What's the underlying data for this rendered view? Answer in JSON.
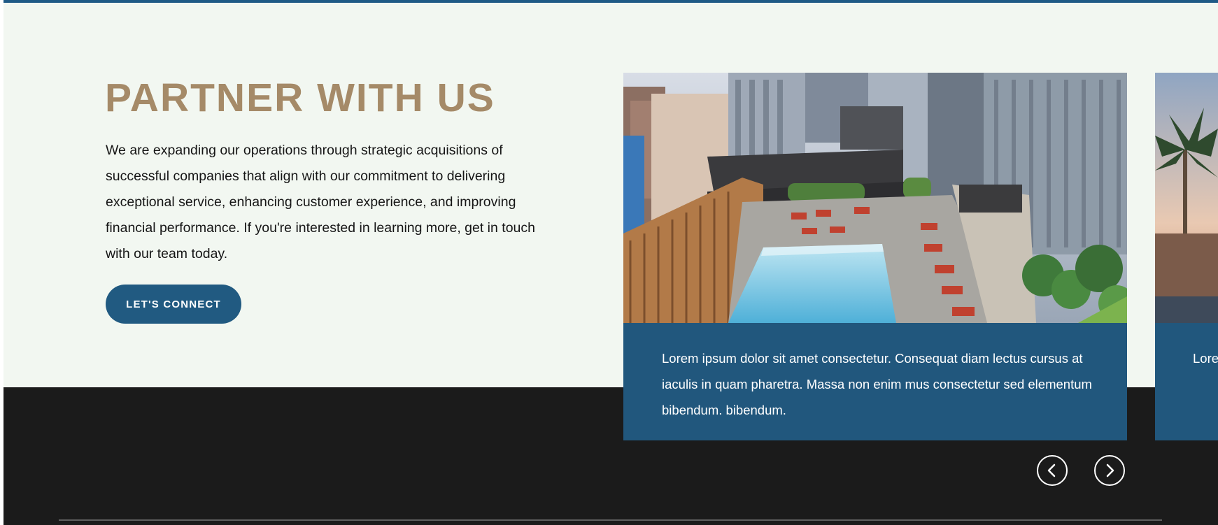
{
  "hero": {
    "title": "PARTNER WITH US",
    "body": "We are expanding our operations through strategic acquisitions of successful companies that align with our commitment to delivering exceptional service, enhancing customer experience, and improving financial performance. If you're interested in learning more, get in touch with our team today.",
    "cta_label": "LET'S CONNECT"
  },
  "carousel": {
    "slides": [
      {
        "image_icon": "rooftop-pool-image",
        "caption": "Lorem ipsum dolor sit amet consectetur. Consequat diam lectus cursus at iaculis in quam pharetra. Massa non enim mus consectetur sed elementum bibendum. bibendum."
      },
      {
        "image_icon": "desert-palm-image",
        "caption": "Lorem cursus sed"
      }
    ],
    "prev_icon": "chevron-left-icon",
    "next_icon": "chevron-right-icon"
  },
  "colors": {
    "accent_gold": "#a58a68",
    "brand_blue": "#215a81",
    "upper_background": "#f2f7f1",
    "lower_background": "#1b1b1b"
  }
}
